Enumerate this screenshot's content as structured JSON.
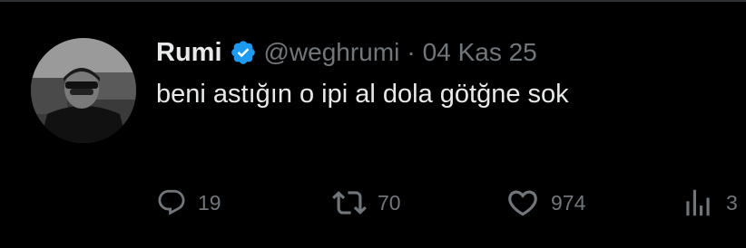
{
  "tweet": {
    "author_name": "Rumi",
    "verified": true,
    "handle": "@weghrumi",
    "separator": "·",
    "date": "04 Kas 25",
    "text": "beni astığın o ipi al dola götğne sok"
  },
  "actions": {
    "reply_count": "19",
    "retweet_count": "70",
    "like_count": "974",
    "views_count": "3"
  },
  "icons": {
    "reply": "reply-icon",
    "retweet": "retweet-icon",
    "like": "heart-icon",
    "views": "views-icon",
    "verified": "verified-badge-icon"
  },
  "colors": {
    "background": "#000000",
    "text_primary": "#e7e9ea",
    "text_secondary": "#71767b",
    "verified_blue": "#1d9bf0"
  }
}
